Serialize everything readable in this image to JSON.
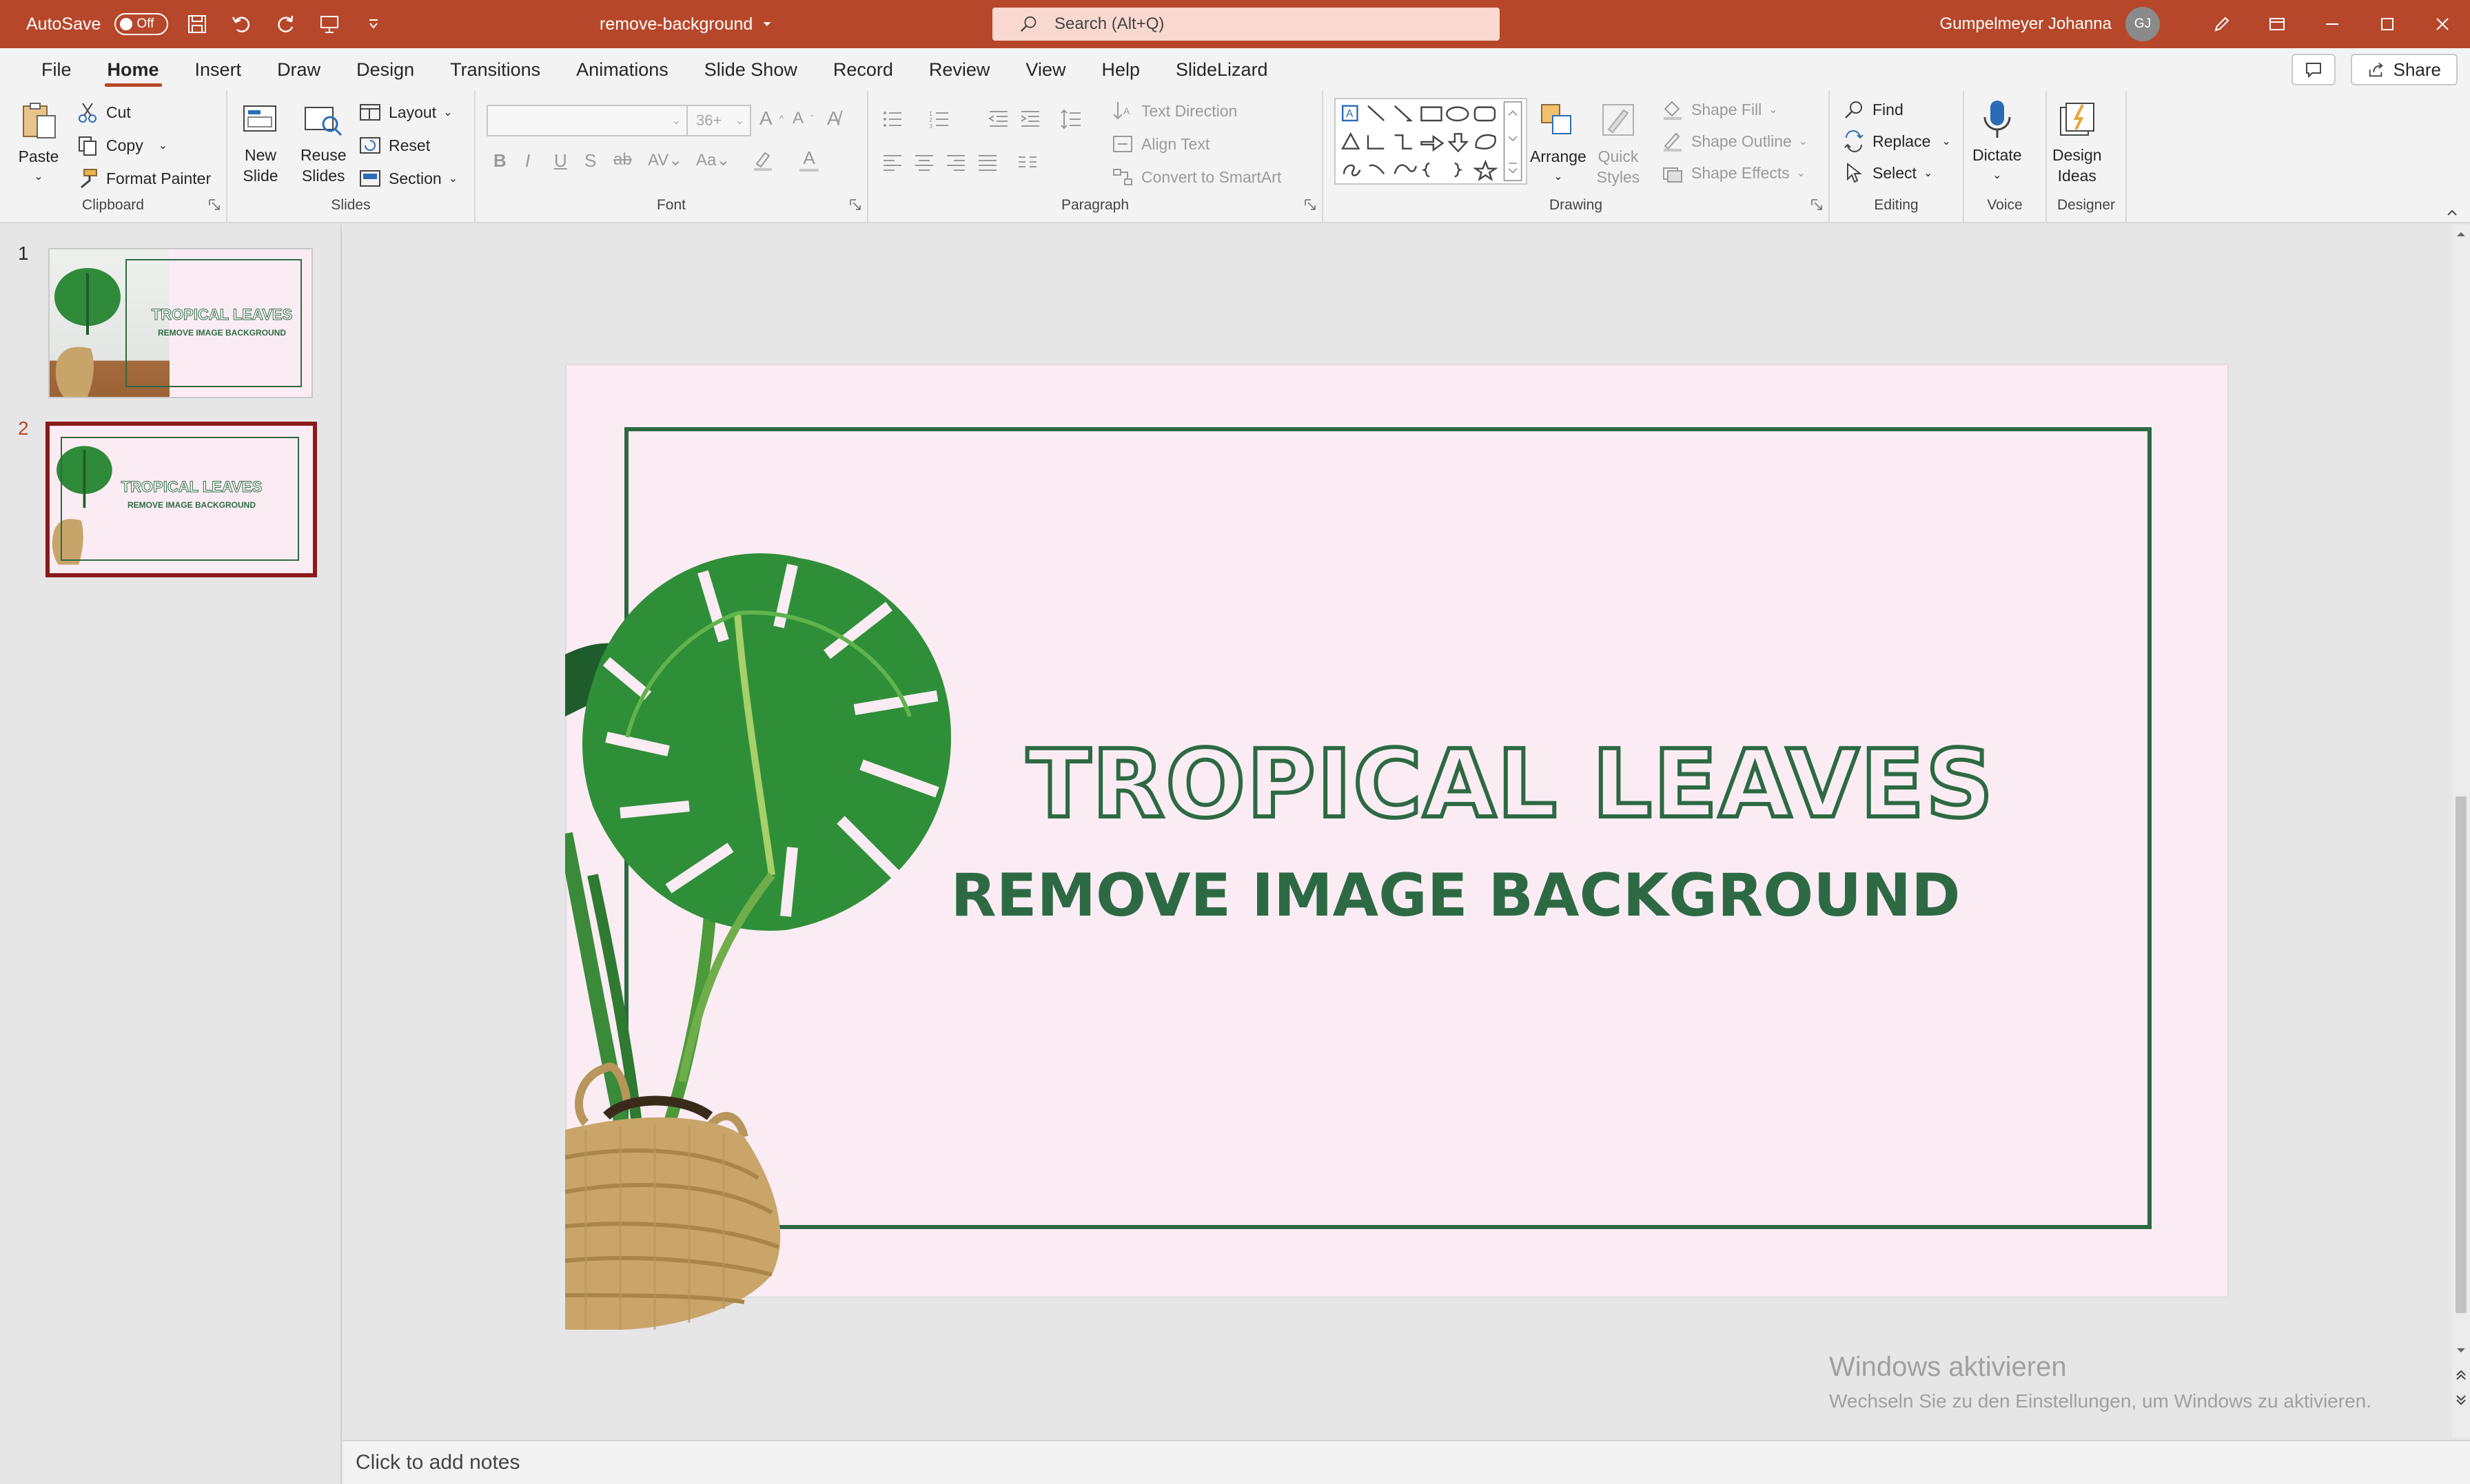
{
  "titlebar": {
    "autosave_label": "AutoSave",
    "autosave_state": "Off",
    "document_title": "remove-background",
    "search_placeholder": "Search (Alt+Q)",
    "user_name": "Gumpelmeyer Johanna",
    "user_initials": "GJ"
  },
  "menu": {
    "tabs": [
      "File",
      "Home",
      "Insert",
      "Draw",
      "Design",
      "Transitions",
      "Animations",
      "Slide Show",
      "Record",
      "Review",
      "View",
      "Help",
      "SlideLizard"
    ],
    "active_tab": "Home",
    "share_label": "Share"
  },
  "ribbon": {
    "clipboard": {
      "label": "Clipboard",
      "paste": "Paste",
      "cut": "Cut",
      "copy": "Copy",
      "format_painter": "Format Painter"
    },
    "slides": {
      "label": "Slides",
      "new_slide_1": "New",
      "new_slide_2": "Slide",
      "reuse_1": "Reuse",
      "reuse_2": "Slides",
      "layout": "Layout",
      "reset": "Reset",
      "section": "Section"
    },
    "font": {
      "label": "Font",
      "size": "36+"
    },
    "paragraph": {
      "label": "Paragraph",
      "text_direction": "Text Direction",
      "align_text": "Align Text",
      "convert_smartart": "Convert to SmartArt"
    },
    "drawing": {
      "label": "Drawing",
      "arrange": "Arrange",
      "quick_1": "Quick",
      "quick_2": "Styles",
      "shape_fill": "Shape Fill",
      "shape_outline": "Shape Outline",
      "shape_effects": "Shape Effects"
    },
    "editing": {
      "label": "Editing",
      "find": "Find",
      "replace": "Replace",
      "select": "Select"
    },
    "voice": {
      "label": "Voice",
      "dictate": "Dictate"
    },
    "designer": {
      "label": "Designer",
      "design_1": "Design",
      "design_2": "Ideas"
    }
  },
  "thumbnails": [
    {
      "number": "1",
      "title": "TROPICAL LEAVES",
      "subtitle": "REMOVE IMAGE BACKGROUND"
    },
    {
      "number": "2",
      "title": "TROPICAL LEAVES",
      "subtitle": "REMOVE IMAGE BACKGROUND"
    }
  ],
  "slide": {
    "title": "TROPICAL LEAVES",
    "subtitle": "REMOVE IMAGE BACKGROUND"
  },
  "watermark": {
    "line1": "Windows aktivieren",
    "line2": "Wechseln Sie zu den Einstellungen, um Windows zu aktivieren."
  },
  "notes": {
    "placeholder": "Click to add notes"
  },
  "colors": {
    "accent": "#b7472a",
    "slide_bg": "#fbecf3",
    "slide_green": "#2d6a44"
  }
}
